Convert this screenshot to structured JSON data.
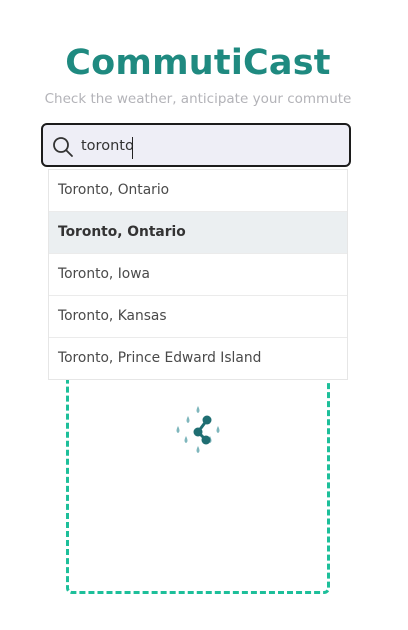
{
  "header": {
    "title": "CommutiCast",
    "subtitle": "Check the weather, anticipate your commute"
  },
  "search": {
    "value": "toronto",
    "icon": "search-icon"
  },
  "suggestions": [
    {
      "label": "Toronto, Ontario",
      "active": false
    },
    {
      "label": "Toronto, Ontario",
      "active": true
    },
    {
      "label": "Toronto, Iowa",
      "active": false
    },
    {
      "label": "Toronto, Kansas",
      "active": false
    },
    {
      "label": "Toronto, Prince Edward Island",
      "active": false
    }
  ],
  "placeholder_visual": {
    "icon": "rain-share-icon",
    "border_color": "#1dbf9a"
  },
  "colors": {
    "brand": "#1f8a80",
    "accent": "#1dbf9a"
  }
}
